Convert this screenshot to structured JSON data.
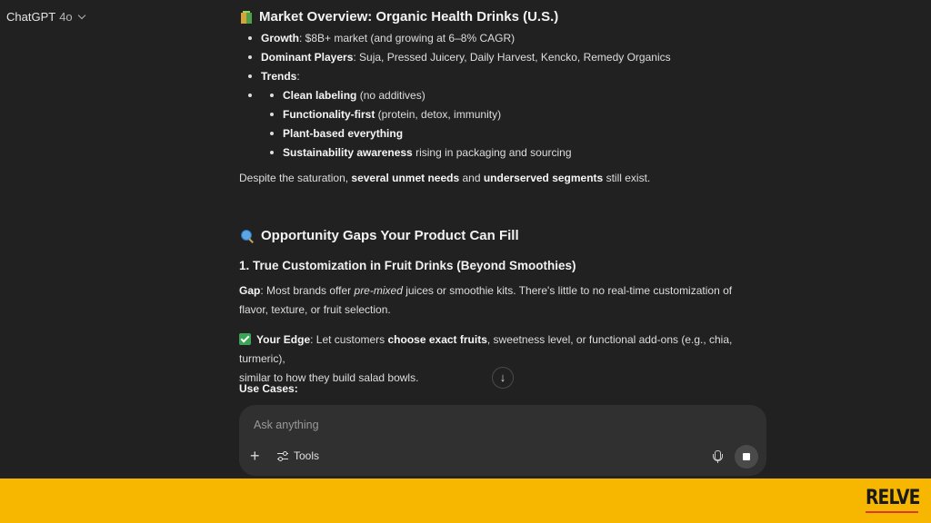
{
  "header": {
    "model_name": "ChatGPT",
    "model_version": "4o"
  },
  "section1": {
    "title": "Market Overview: Organic Health Drinks (U.S.)",
    "icon": "juice-box-icon",
    "bullets": [
      {
        "label": "Growth",
        "text": ": $8B+ market (and growing at 6–8% CAGR)"
      },
      {
        "label": "Dominant Players",
        "text": ": Suja, Pressed Juicery, Daily Harvest, Kencko, Remedy Organics"
      },
      {
        "label": "Trends",
        "text": ":"
      }
    ],
    "trends": [
      {
        "label": "Clean labeling",
        "text": " (no additives)"
      },
      {
        "label": "Functionality-first",
        "text": " (protein, detox, immunity)"
      },
      {
        "label": "Plant-based everything",
        "text": ""
      },
      {
        "label": "Sustainability awareness",
        "text": " rising in packaging and sourcing"
      }
    ],
    "summary": {
      "pre": "Despite the saturation, ",
      "b1": "several unmet needs",
      "mid": " and ",
      "b2": "underserved segments",
      "post": " still exist."
    }
  },
  "section2": {
    "title": "Opportunity Gaps Your Product Can Fill",
    "icon": "magnifying-glass-icon",
    "subtitle": "1. True Customization in Fruit Drinks (Beyond Smoothies)",
    "gap": {
      "label": "Gap",
      "pre": ": Most brands offer ",
      "em": "pre-mixed",
      "line1_post": " juices or smoothie kits. There's little to no real-time customization of",
      "line2": "flavor, texture, or fruit selection."
    },
    "edge": {
      "label": "Your Edge",
      "pre": ": Let customers ",
      "b": "choose exact fruits",
      "line1_post": ", sweetness level, or functional add-ons (e.g., chia, turmeric),",
      "line2": "similar to how they build salad bowls."
    },
    "use_cases": "Use Cases:"
  },
  "composer": {
    "placeholder": "Ask anything",
    "tools_label": "Tools"
  },
  "branding": {
    "logo_text": "RELVE",
    "banner_color": "#f7b701"
  }
}
